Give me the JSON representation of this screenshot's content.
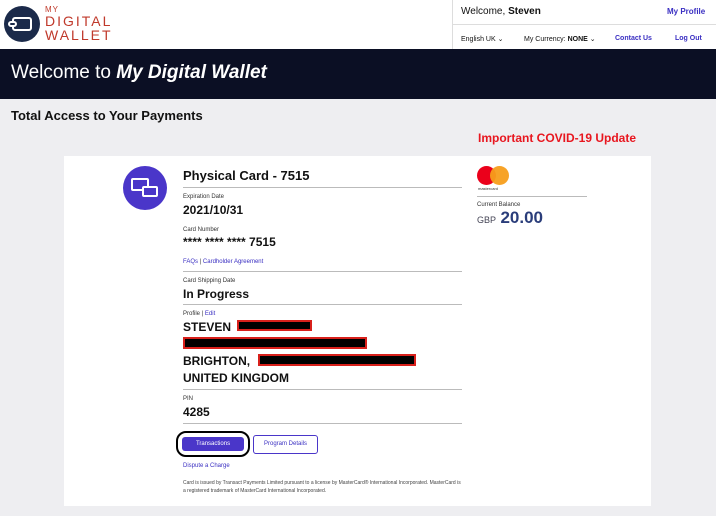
{
  "header": {
    "logo_small": "MY",
    "logo_line1": "DIGITAL",
    "logo_line2": "WALLET",
    "welcome_prefix": "Welcome,",
    "user_name": "Steven",
    "my_profile": "My Profile",
    "language": "English UK",
    "currency_label": "My Currency:",
    "currency_value": "NONE",
    "contact_us": "Contact Us",
    "log_out": "Log Out"
  },
  "banner": {
    "prefix": "Welcome to",
    "brand": "My Digital Wallet"
  },
  "section_title": "Total Access to Your Payments",
  "covid_link": "Important COVID-19 Update",
  "card": {
    "title": "Physical Card - 7515",
    "expiration_label": "Expiration Date",
    "expiration_value": "2021/10/31",
    "number_label": "Card Number",
    "number_value": "**** **** **** 7515",
    "faqs_link": "FAQs",
    "agreement_link": "Cardholder Agreement",
    "shipping_label": "Card Shipping Date",
    "shipping_value": "In Progress",
    "profile_label": "Profile",
    "edit_link": "Edit",
    "profile_name": "STEVEN",
    "profile_city": "BRIGHTON,",
    "profile_country": "UNITED KINGDOM",
    "pin_label": "PIN",
    "pin_value": "4285",
    "transactions_button": "Transactions",
    "program_details_button": "Program Details",
    "dispute_link": "Dispute a Charge",
    "legal_text": "Card is issued by Transact Payments Limited pursuant to a license by MasterCard® International Incorporated. MasterCard is a registered trademark of MasterCard International Incorporated."
  },
  "balance": {
    "brand_label": "mastercard",
    "label": "Current Balance",
    "currency": "GBP",
    "amount": "20.00"
  },
  "colors": {
    "accent": "#4a36c9",
    "banner": "#0b0f24",
    "alert": "#e8161f",
    "logo": "#c0392b"
  },
  "icons": {
    "logo": "wallet-icon",
    "card": "card-mail-icon",
    "chevron": "chevron-down-icon"
  }
}
